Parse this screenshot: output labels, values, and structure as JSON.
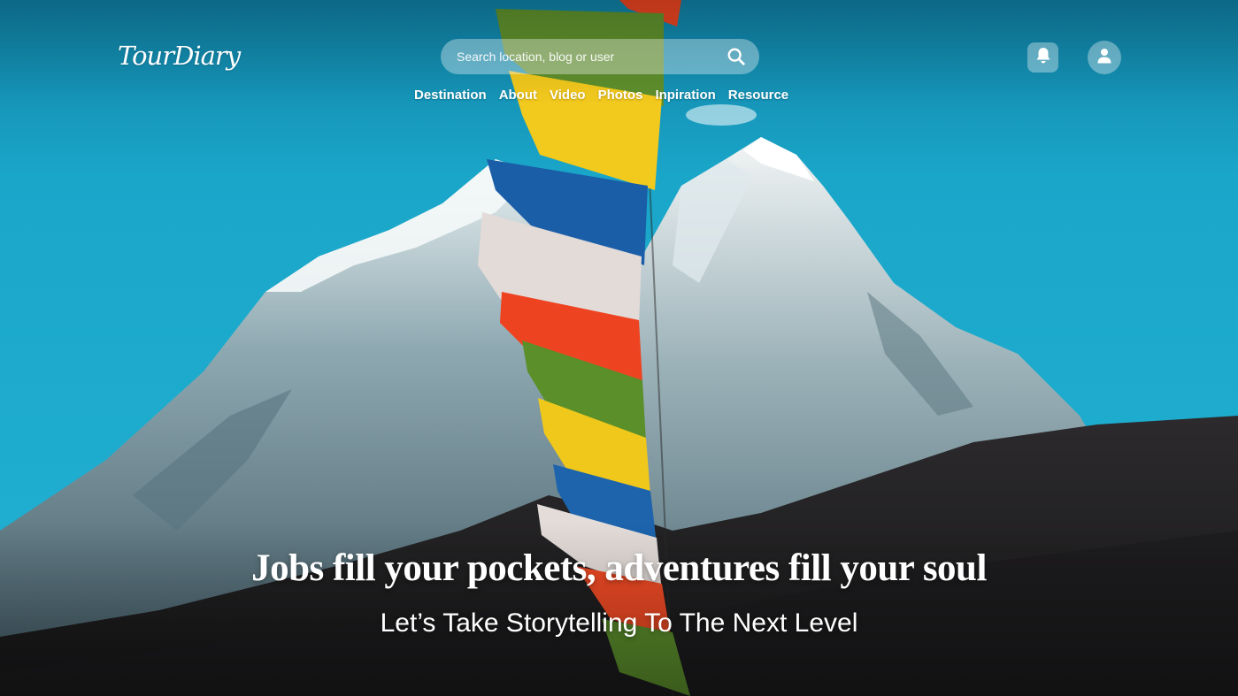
{
  "brand": {
    "logo_text": "TourDiary"
  },
  "search": {
    "placeholder": "Search location, blog or user",
    "value": "",
    "icon": "search-icon"
  },
  "nav": {
    "items": [
      {
        "label": "Destination"
      },
      {
        "label": "About"
      },
      {
        "label": "Video"
      },
      {
        "label": "Photos"
      },
      {
        "label": "Inpiration"
      },
      {
        "label": "Resource"
      }
    ]
  },
  "header_actions": {
    "notifications_icon": "bell-icon",
    "profile_icon": "user-icon"
  },
  "hero": {
    "background": "mountain-with-prayer-flags-photo",
    "headline": "Jobs fill your pockets, adventures fill your soul",
    "subheadline": "Let’s Take Storytelling To The Next Level"
  },
  "colors": {
    "sky": "#1faccc",
    "ui_glass": "rgba(255,255,255,0.35)",
    "text": "#ffffff"
  }
}
